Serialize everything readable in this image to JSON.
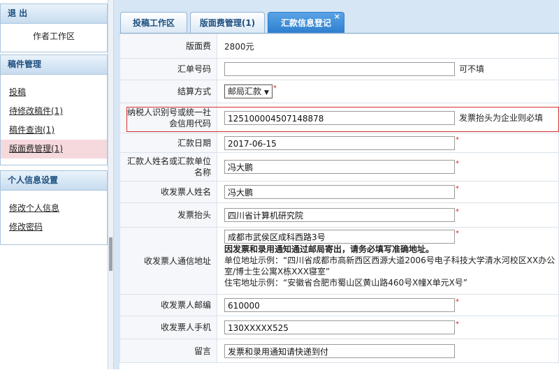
{
  "sidebar": {
    "exit_title": "退 出",
    "workspace": "作者工作区",
    "manuscript_title": "稿件管理",
    "manuscript_items": [
      "投稿",
      "待修改稿件(1)",
      "稿件查询(1)",
      "版面费管理(1)"
    ],
    "personal_title": "个人信息设置",
    "personal_items": [
      "修改个人信息",
      "修改密码"
    ]
  },
  "tabs": [
    {
      "label": "投稿工作区"
    },
    {
      "label": "版面费管理(1)"
    },
    {
      "label": "汇款信息登记",
      "close": "×"
    }
  ],
  "form": {
    "fee_label": "版面费",
    "fee_value": "2800元",
    "remit_no_label": "汇单号码",
    "remit_no_value": "",
    "remit_no_hint": "可不填",
    "settle_label": "结算方式",
    "settle_value": "邮局汇款",
    "taxid_label": "纳税人识别号或统一社会信用代码",
    "taxid_value": "12510000450714887​8",
    "taxid_hint": "发票抬头为企业则必填",
    "date_label": "汇款日期",
    "date_value": "2017-06-15",
    "remitter_label": "汇款人姓名或汇款单位名称",
    "remitter_value": "冯大鹏",
    "receiver_label": "收发票人姓名",
    "receiver_value": "冯大鹏",
    "invoice_title_label": "发票抬头",
    "invoice_title_value": "四川省计算机研究院",
    "address_label": "收发票人通信地址",
    "address_value": "成都市武侯区成科西路3号",
    "address_warning": "因发票和录用通知通过邮局寄出，请务必填写准确地址。",
    "address_example1": "单位地址示例：“四川省成都市高新西区西源大道2006号电子科技大学清水河校区XX办公室/博士生公寓X栋XXX寝室”",
    "address_example2": "住宅地址示例：“安徽省合肥市蜀山区黄山路460号X幢X单元X号”",
    "zip_label": "收发票人邮编",
    "zip_value": "610000",
    "phone_label": "收发票人手机",
    "phone_value": "130XXXXX525",
    "message_label": "留言",
    "message_value": "发票和录用通知请快递到付",
    "required_mark": "*"
  }
}
